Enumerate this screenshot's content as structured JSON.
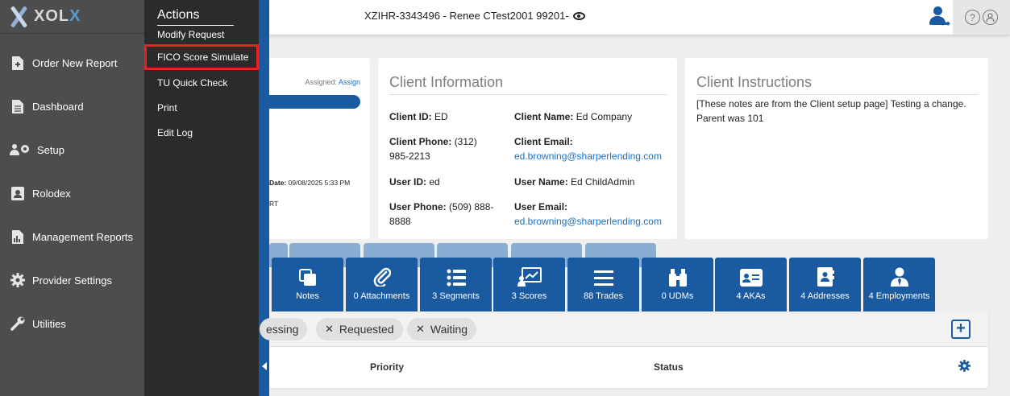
{
  "brand": {
    "name_prefix": "XOL",
    "name_suffix": "X"
  },
  "sidebar": {
    "items": [
      {
        "label": "Order New Report",
        "icon": "file-plus-icon"
      },
      {
        "label": "Dashboard",
        "icon": "document-icon"
      },
      {
        "label": "Setup",
        "icon": "users-gear-icon"
      },
      {
        "label": "Rolodex",
        "icon": "contact-card-icon"
      },
      {
        "label": "Management Reports",
        "icon": "report-chart-icon"
      },
      {
        "label": "Provider Settings",
        "icon": "gear-icon"
      },
      {
        "label": "Utilities",
        "icon": "wrench-icon"
      }
    ]
  },
  "actions": {
    "title": "Actions",
    "items": [
      "Modify Request",
      "FICO Score Simulate",
      "TU Quick Check",
      "Print",
      "Edit Log"
    ],
    "highlighted": "FICO Score Simulate"
  },
  "header": {
    "order_title": "XZIHR-3343496 - Renee CTest2001 99201-"
  },
  "order_card": {
    "assigned_label": "Assigned:",
    "assign_link": "Assign",
    "date_label": "Date:",
    "date_value": "09/08/2025 5:33 PM",
    "rt_text": "RT"
  },
  "client_info": {
    "title": "Client Information",
    "client_id_label": "Client ID:",
    "client_id": "ED",
    "client_name_label": "Client Name:",
    "client_name": "Ed Company",
    "client_phone_label": "Client Phone:",
    "client_phone_1": "(312)",
    "client_phone_2": "985-2213",
    "client_email_label": "Client Email:",
    "client_email": "ed.browning@sharperlending.com",
    "user_id_label": "User ID:",
    "user_id": "ed",
    "user_name_label": "User Name:",
    "user_name": "Ed ChildAdmin",
    "user_phone_label": "User Phone:",
    "user_phone_1": "(509) 888-",
    "user_phone_2": "8888",
    "user_email_label": "User Email:",
    "user_email": "ed.browning@sharperlending.com"
  },
  "client_instructions": {
    "title": "Client Instructions",
    "text": "[These notes are from the Client setup page] Testing a change. Parent was 101"
  },
  "tiles": [
    {
      "label": "Notes",
      "icon": "notes-icon"
    },
    {
      "label": "0 Attachments",
      "icon": "paperclip-icon"
    },
    {
      "label": "3 Segments",
      "icon": "list-icon"
    },
    {
      "label": "3 Scores",
      "icon": "chart-score-icon"
    },
    {
      "label": "88 Trades",
      "icon": "lines-icon"
    },
    {
      "label": "0 UDMs",
      "icon": "binoculars-icon"
    },
    {
      "label": "4 AKAs",
      "icon": "id-card-icon"
    },
    {
      "label": "4 Addresses",
      "icon": "address-book-icon"
    },
    {
      "label": "4 Employments",
      "icon": "person-tie-icon"
    }
  ],
  "filters": {
    "chips": [
      "essing",
      "Requested",
      "Waiting"
    ]
  },
  "table": {
    "columns": [
      "Priority",
      "Status"
    ]
  },
  "colors": {
    "brand_blue": "#1a5aa0",
    "sidebar": "#4d4d4d",
    "flyout": "#2b2b2b",
    "highlight": "#e52421"
  }
}
